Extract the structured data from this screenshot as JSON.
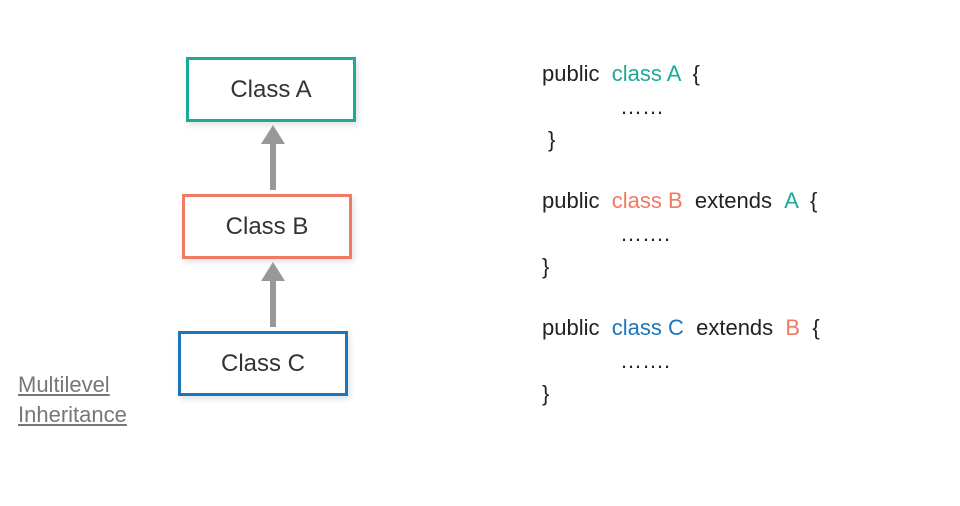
{
  "caption": {
    "line1": "Multilevel",
    "line2": "Inheritance"
  },
  "boxes": {
    "a": "Class A",
    "b": "Class B",
    "c": "Class C"
  },
  "code": {
    "blockA": {
      "public": "public",
      "class_kw": "class A",
      "brace_open": "{",
      "body": "……",
      "brace_close": "}"
    },
    "blockB": {
      "public": "public",
      "class_kw": "class B",
      "extends": "extends",
      "parent": "A",
      "brace_open": "{",
      "body": "…….",
      "brace_close": "}"
    },
    "blockC": {
      "public": "public",
      "class_kw": "class C",
      "extends": "extends",
      "parent": "B",
      "brace_open": "{",
      "body": "…….",
      "brace_close": "}"
    }
  },
  "colors": {
    "teal": "#1baa97",
    "red": "#f07a63",
    "blue": "#1a76bc",
    "arrow": "#989898"
  }
}
